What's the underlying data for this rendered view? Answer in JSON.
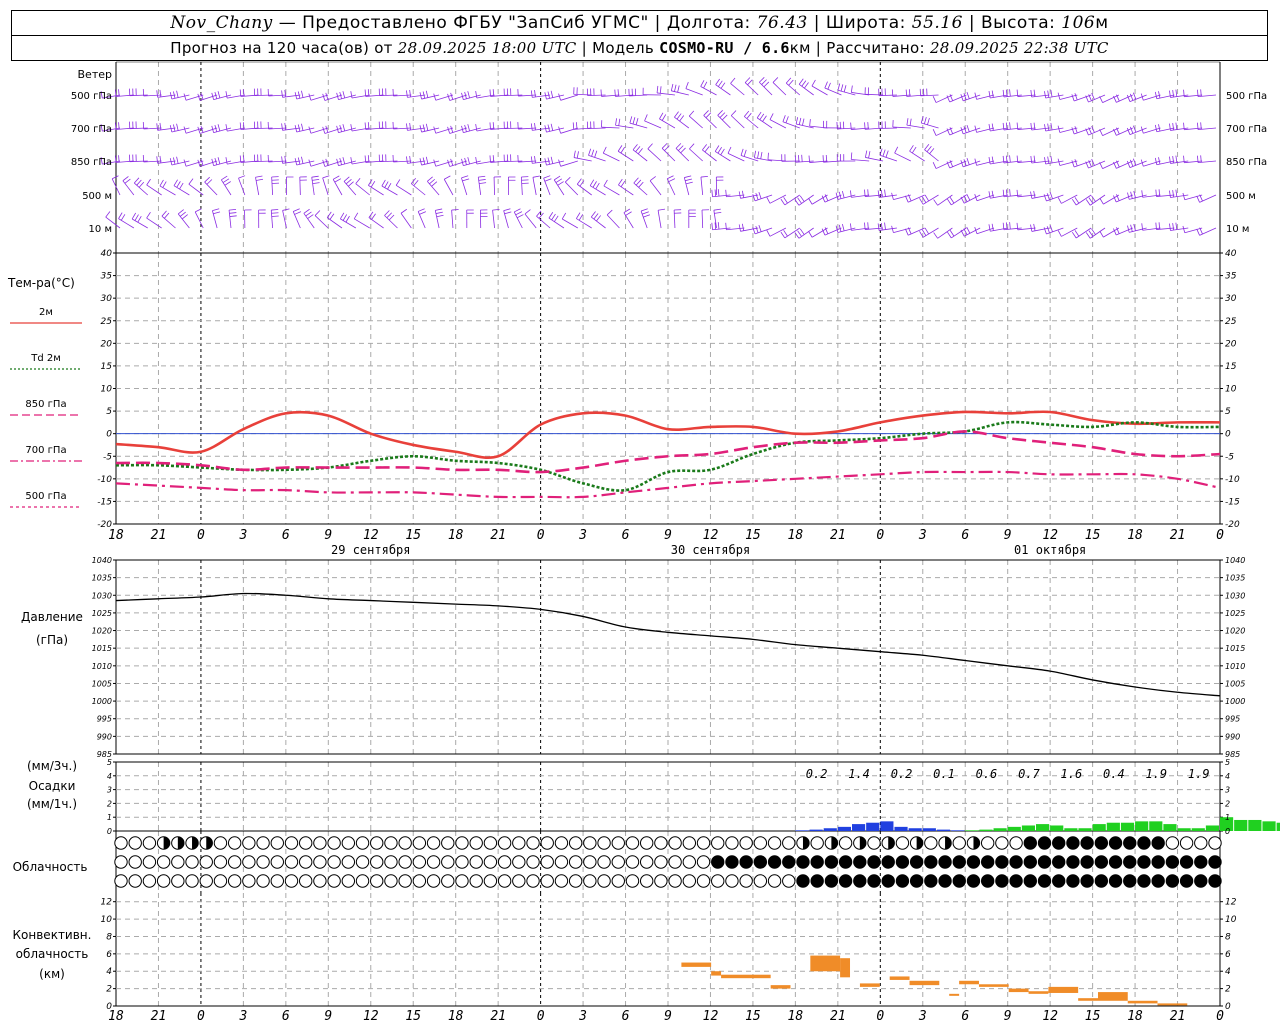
{
  "header": {
    "station": "Nov_Chany",
    "provider": "— Предоставлено ФГБУ \"ЗапСиб УГМС\"",
    "lon_label": "Долгота:",
    "lon": "76.43",
    "lat_label": "Широта:",
    "lat": "55.16",
    "alt_label": "Высота:",
    "alt": "106",
    "alt_unit": "м",
    "forecast_prefix": "Прогноз на 120 часа(ов) от",
    "forecast_start": "28.09.2025 18:00 UTC",
    "model_label": "Модель",
    "model": "COSMO-RU / 6.6",
    "model_unit": "км",
    "computed_label": "Рассчитано:",
    "computed": "28.09.2025 22:38 UTC"
  },
  "wind_panel": {
    "title": "Ветер",
    "levels": [
      "500 гПа",
      "700 гПа",
      "850 гПа",
      "500 м",
      "10 м"
    ]
  },
  "temp_panel": {
    "title": "Тем-ра(°С)",
    "legend": [
      "2м",
      "Td 2м",
      "850 гПа",
      "700 гПа",
      "500 гПа"
    ]
  },
  "pressure_panel": {
    "title": "Давление",
    "unit": "(гПа)"
  },
  "precip_panel": {
    "unit3h": "(мм/3ч.)",
    "title": "Осадки",
    "unit1h": "(мм/1ч.)"
  },
  "cloud_panel": {
    "title": "Облачность"
  },
  "conv_panel": {
    "title_1": "Конвективн.",
    "title_2": "облачность",
    "unit": "(км)"
  },
  "time_axis": {
    "hour_labels": [
      "18",
      "21",
      "0",
      "3",
      "6",
      "9",
      "12",
      "15",
      "18",
      "21",
      "0",
      "3",
      "6",
      "9",
      "12",
      "15",
      "18",
      "21",
      "0",
      "3",
      "6",
      "9",
      "12",
      "15",
      "18",
      "21",
      "0"
    ],
    "days": [
      "29 сентября",
      "30 сентября",
      "01 октября"
    ]
  },
  "colors": {
    "t2m": "#e8403a",
    "td2m": "#1a7a1a",
    "t850": "#e0207a",
    "t700": "#e0207a",
    "t500": "#e0207a",
    "wind": "#8a2be2",
    "rain_blue": "#2040e0",
    "rain_green": "#20d020",
    "conv": "#f08c28"
  },
  "chart_data": [
    {
      "type": "line",
      "title": "Тем-ра(°С)",
      "x": [
        0,
        3,
        6,
        9,
        12,
        15,
        18,
        21,
        24,
        27,
        30,
        33,
        36,
        39,
        42,
        45,
        48,
        51,
        54,
        57,
        60,
        63,
        66,
        69,
        72,
        75,
        78
      ],
      "ylim": [
        -20,
        40
      ],
      "series": [
        {
          "name": "2м",
          "values": [
            -2.3,
            -3,
            -4,
            1,
            4.5,
            4,
            0,
            -2.5,
            -4,
            -5,
            2,
            4.5,
            4,
            1,
            1.5,
            1.5,
            0,
            0.5,
            2.5,
            4,
            4.8,
            4.5,
            4.8,
            3,
            2.2,
            2.5,
            2.5
          ]
        },
        {
          "name": "Td 2м",
          "values": [
            -7,
            -7,
            -7.5,
            -8,
            -8,
            -7.5,
            -6,
            -5,
            -6,
            -6.5,
            -8,
            -11,
            -12.5,
            -8.5,
            -8,
            -4.5,
            -2,
            -1.5,
            -1,
            0,
            0.5,
            2.5,
            2,
            1.5,
            2.5,
            1.5,
            1.5
          ]
        },
        {
          "name": "850 гПа",
          "values": [
            -6.5,
            -6.5,
            -7,
            -8,
            -7.5,
            -7.5,
            -7.5,
            -7.5,
            -8,
            -8,
            -8.5,
            -7.5,
            -6,
            -5,
            -4.5,
            -3,
            -2,
            -2,
            -1.5,
            -1,
            0.5,
            -1,
            -2,
            -3,
            -4.5,
            -5,
            -4.5
          ]
        },
        {
          "name": "700 гПа",
          "values": [
            -11,
            -11.5,
            -12,
            -12.5,
            -12.5,
            -13,
            -13,
            -13,
            -13.5,
            -14,
            -14,
            -14,
            -13,
            -12,
            -11,
            -10.5,
            -10,
            -9.5,
            -9,
            -8.5,
            -8.5,
            -8.5,
            -9,
            -9,
            -9,
            -10,
            -12
          ]
        }
      ]
    },
    {
      "type": "line",
      "title": "Давление",
      "ylabel": "(гПа)",
      "x": [
        0,
        3,
        6,
        9,
        12,
        15,
        18,
        21,
        24,
        27,
        30,
        33,
        36,
        39,
        42,
        45,
        48,
        51,
        54,
        57,
        60,
        63,
        66,
        69,
        72,
        75,
        78
      ],
      "ylim": [
        985,
        1040
      ],
      "series": [
        {
          "name": "Давление",
          "values": [
            1028.5,
            1029,
            1029.5,
            1030.5,
            1030,
            1029,
            1028.5,
            1028,
            1027.5,
            1027,
            1026,
            1024,
            1021,
            1019.5,
            1018.5,
            1017.5,
            1016,
            1015,
            1014,
            1013,
            1011.5,
            1010,
            1008.5,
            1006,
            1004,
            1002.5,
            1001.5
          ]
        }
      ]
    },
    {
      "type": "bar",
      "title": "Осадки",
      "ylabel": "(мм/1ч.)",
      "ylim": [
        0,
        5
      ],
      "totals_3h": [
        {
          "hour": 3,
          "value": "0.2"
        },
        {
          "hour": 6,
          "value": "1.4"
        },
        {
          "hour": 9,
          "value": "0.2"
        },
        {
          "hour": 12,
          "value": "0.1"
        },
        {
          "hour": 15,
          "value": "0.6"
        },
        {
          "hour": 18,
          "value": "0.7"
        },
        {
          "hour": 21,
          "value": "1.6"
        },
        {
          "hour": 24,
          "value": "0.4"
        },
        {
          "hour": 27,
          "value": "1.9"
        },
        {
          "hour": 30,
          "value": "1.9"
        }
      ],
      "start_hour": 48,
      "series": [
        {
          "name": "blue",
          "values": [
            0.05,
            0.1,
            0.2,
            0.3,
            0.5,
            0.6,
            0.7,
            0.3,
            0.2,
            0.2,
            0.1,
            0.05
          ]
        },
        {
          "name": "green",
          "values": [
            0.05,
            0.1,
            0.2,
            0.3,
            0.4,
            0.5,
            0.4,
            0.2,
            0.2,
            0.5,
            0.6,
            0.6,
            0.7,
            0.7,
            0.5,
            0.2,
            0.2,
            0.4,
            1.0,
            0.8,
            0.8,
            0.7,
            0.6
          ]
        }
      ]
    },
    {
      "type": "bar",
      "title": "Конвективн. облачность",
      "ylabel": "(км)",
      "ylim": [
        0,
        13
      ],
      "bars": [
        {
          "x0": 57,
          "x1": 60,
          "base": 4.5,
          "top": 5
        },
        {
          "x0": 60,
          "x1": 61,
          "base": 3.5,
          "top": 4
        },
        {
          "x0": 61,
          "x1": 66,
          "base": 3.2,
          "top": 3.6
        },
        {
          "x0": 66,
          "x1": 68,
          "base": 2,
          "top": 2.4
        },
        {
          "x0": 70,
          "x1": 73,
          "base": 4,
          "top": 5.8
        },
        {
          "x0": 73,
          "x1": 74,
          "base": 3.3,
          "top": 5.5
        },
        {
          "x0": 75,
          "x1": 77,
          "base": 2.2,
          "top": 2.6
        },
        {
          "x0": 78,
          "x1": 80,
          "base": 3,
          "top": 3.4
        },
        {
          "x0": 80,
          "x1": 83,
          "base": 2.4,
          "top": 2.9
        },
        {
          "x0": 84,
          "x1": 85,
          "base": 1.2,
          "top": 1.4
        },
        {
          "x0": 85,
          "x1": 87,
          "base": 2.5,
          "top": 2.9
        },
        {
          "x0": 87,
          "x1": 90,
          "base": 2.2,
          "top": 2.5
        },
        {
          "x0": 90,
          "x1": 92,
          "base": 1.6,
          "top": 2.0
        },
        {
          "x0": 92,
          "x1": 94,
          "base": 1.4,
          "top": 1.7
        },
        {
          "x0": 94,
          "x1": 97,
          "base": 1.5,
          "top": 2.2
        },
        {
          "x0": 97,
          "x1": 99,
          "base": 0.6,
          "top": 0.9
        },
        {
          "x0": 99,
          "x1": 102,
          "base": 0.6,
          "top": 1.6
        },
        {
          "x0": 102,
          "x1": 105,
          "base": 0.3,
          "top": 0.6
        },
        {
          "x0": 105,
          "x1": 108,
          "base": 0.1,
          "top": 0.3
        }
      ]
    }
  ]
}
